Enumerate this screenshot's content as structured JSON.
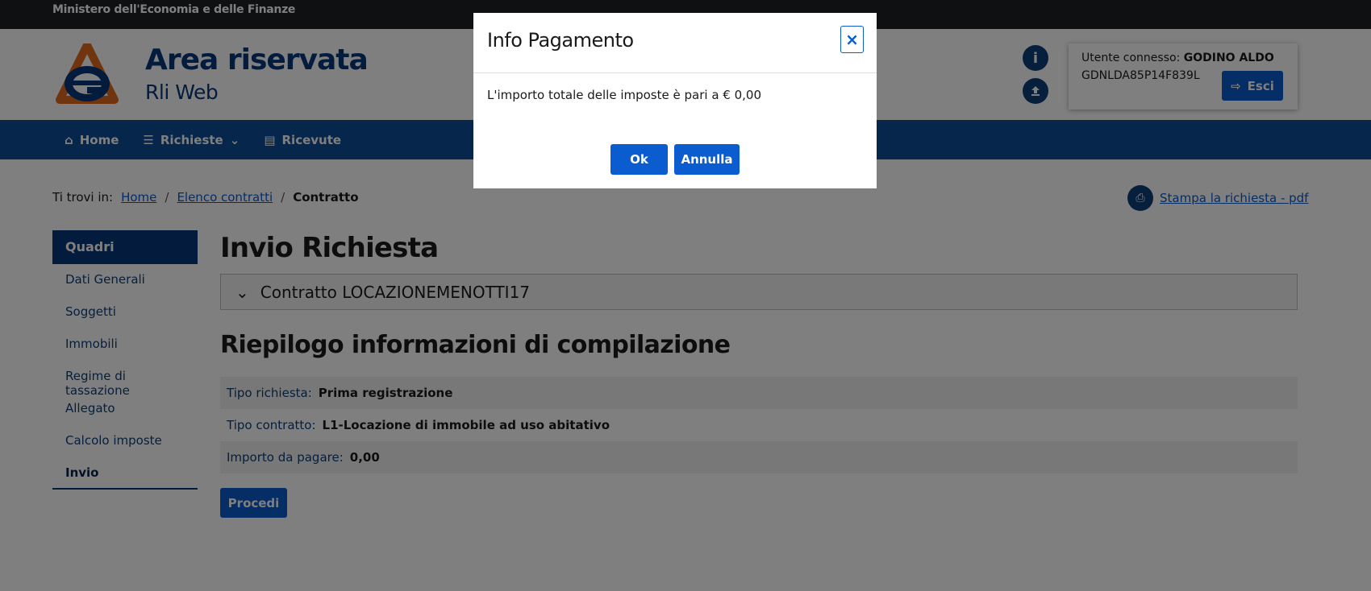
{
  "topbar": {
    "ministry": "Ministero dell'Economia e delle Finanze"
  },
  "header": {
    "title": "Area riservata",
    "subtitle": "Rli Web",
    "user_label": "Utente connesso:",
    "user_name": "GODINO ALDO",
    "user_cf": "GDNLDA85P14F839L",
    "logout_label": "Esci"
  },
  "nav": {
    "items": [
      {
        "label": "Home",
        "icon": "home-icon"
      },
      {
        "label": "Richieste",
        "icon": "list-icon"
      },
      {
        "label": "Ricevute",
        "icon": "document-icon"
      }
    ]
  },
  "breadcrumb": {
    "prefix": "Ti trovi in:",
    "items": [
      "Home",
      "Elenco contratti",
      "Contratto"
    ]
  },
  "print_link": "Stampa la richiesta - pdf",
  "sidebar": {
    "heading": "Quadri",
    "items": [
      "Dati Generali",
      "Soggetti",
      "Immobili",
      "Regime di tassazione",
      "Allegato",
      "Calcolo imposte",
      "Invio"
    ]
  },
  "main": {
    "title": "Invio Richiesta",
    "accordion_label": "Contratto LOCAZIONEMENOTTI17",
    "summary_title": "Riepilogo informazioni di compilazione",
    "rows": [
      {
        "label": "Tipo richiesta:",
        "value": "Prima registrazione"
      },
      {
        "label": "Tipo contratto:",
        "value": "L1-Locazione di immobile ad uso abitativo"
      },
      {
        "label": "Importo da pagare:",
        "value": "0,00"
      }
    ],
    "procedi_label": "Procedi"
  },
  "modal": {
    "title": "Info Pagamento",
    "close_glyph": "×",
    "body": "L'importo totale delle imposte è pari a € 0,00",
    "ok_label": "Ok",
    "cancel_label": "Annulla"
  },
  "colors": {
    "brand_dark": "#06397a",
    "nav_blue": "#0c4d99",
    "button_blue": "#0a5ccf",
    "topbar": "#1c2024"
  }
}
